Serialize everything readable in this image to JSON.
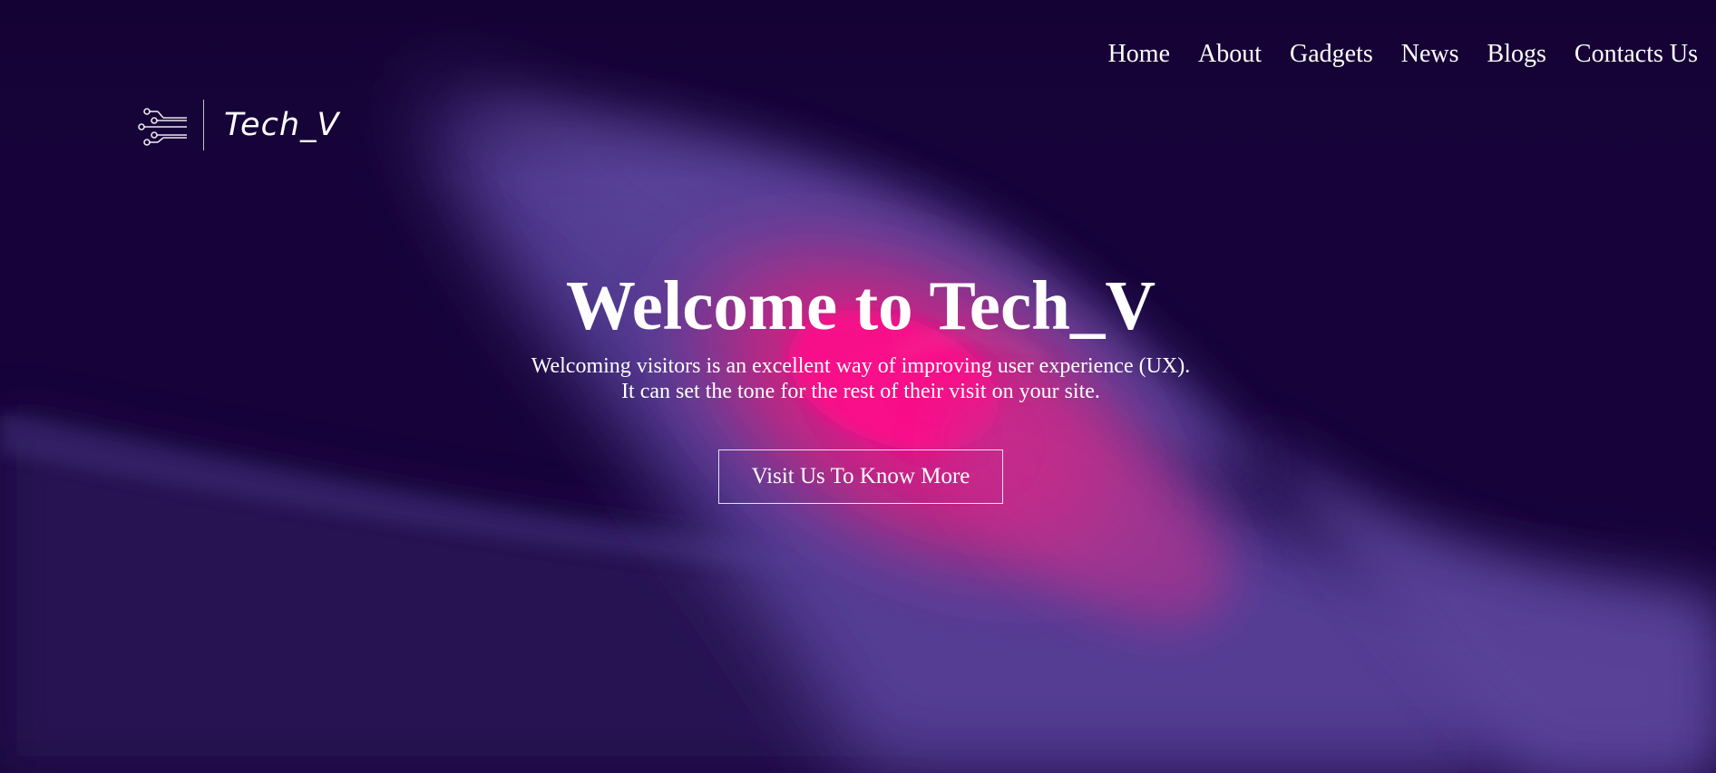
{
  "nav": {
    "items": [
      {
        "label": "Home"
      },
      {
        "label": "About"
      },
      {
        "label": "Gadgets"
      },
      {
        "label": "News"
      },
      {
        "label": "Blogs"
      },
      {
        "label": "Contacts Us"
      }
    ]
  },
  "logo": {
    "text": "Tech_V",
    "icon": "circuit-lines-icon"
  },
  "hero": {
    "title": "Welcome to Tech_V",
    "subtitle_line1": "Welcoming visitors is an excellent way of improving user experience (UX).",
    "subtitle_line2": "It can set the tone for the rest of their visit on your site.",
    "cta_label": "Visit Us To Know More"
  },
  "colors": {
    "background_dark": "#17033a",
    "wave_purple": "#553d94",
    "wave_pink": "#ff0b8a",
    "text": "#ffffff"
  }
}
